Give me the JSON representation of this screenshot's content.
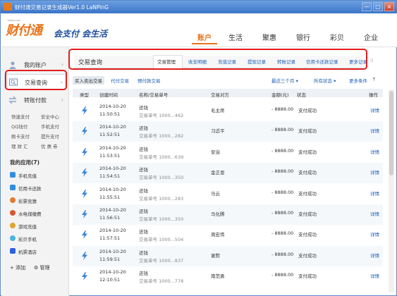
{
  "window": {
    "title": "财付通交易记录生成器Ver1.0  LaNPinG",
    "controls": [
      "—",
      "□",
      "×"
    ]
  },
  "brand": {
    "logo_main": "财付通",
    "logo_sub": "会支付 会生活",
    "logo_tag": "TENPAY.COM"
  },
  "nav": {
    "tabs": [
      "账户",
      "生活",
      "聚惠",
      "银行",
      "彩贝",
      "企业"
    ],
    "active": "账户"
  },
  "sidebar": {
    "items": [
      {
        "label": "我的账户",
        "icon": "user-icon"
      },
      {
        "label": "交易查询",
        "icon": "search-icon"
      },
      {
        "label": "转账付款",
        "icon": "transfer-icon"
      }
    ],
    "active": "交易查询",
    "shortcuts": [
      "快速支付",
      "安全中心",
      "QQ钱付",
      "手机支付",
      "刷卡支付",
      "提升支付",
      "理 财 汇",
      "优 惠 券"
    ],
    "apps_title": "我的应用(7)",
    "apps": [
      {
        "label": "手机充值",
        "color": "#2f8ee0"
      },
      {
        "label": "信用卡还款",
        "color": "#2f8ee0"
      },
      {
        "label": "彩票竞猜",
        "color": "#e07a2f"
      },
      {
        "label": "水电煤缴费",
        "color": "#e0532f"
      },
      {
        "label": "游戏充值",
        "color": "#e0a42f"
      },
      {
        "label": "彩贝手机",
        "color": "#4bb3e0"
      },
      {
        "label": "机票酒店",
        "color": "#2f5fe0"
      }
    ],
    "footer": {
      "add": "添加",
      "manage": "管理"
    }
  },
  "main": {
    "title": "交易查询",
    "subtabs": [
      "交易管理",
      "收支明细",
      "充值记录",
      "提现记录",
      "转账记录",
      "信用卡还款记录",
      "更多记录"
    ],
    "active_subtab": "交易管理",
    "filters": [
      "买入卖出交易",
      "代付交易",
      "预付款交易"
    ],
    "active_filter": "买入卖出交易",
    "range": "最近三个月 ▾",
    "status_filter": "所有状态 ▾",
    "more": "更多条件",
    "headers": [
      "类型",
      "创建时间",
      "名称/交易单号",
      "交易对方",
      "金额(元)",
      "状态",
      "操作"
    ],
    "rows": [
      {
        "date": "2014-10-20",
        "time": "11:50:51",
        "name": "还钱",
        "order": "交易单号 1000...462",
        "party": "毛主席",
        "amount": "- 8888.00",
        "status": "支付成功",
        "action": "详情"
      },
      {
        "date": "2014-10-20",
        "time": "11:52:51",
        "name": "还钱",
        "order": "交易单号 1000...282",
        "party": "习近平",
        "amount": "- 8888.00",
        "status": "支付成功",
        "action": "详情"
      },
      {
        "date": "2014-10-20",
        "time": "11:53:51",
        "name": "还钱",
        "order": "交易单号 1000...639",
        "party": "安溢",
        "amount": "- 8888.00",
        "status": "支付成功",
        "action": "详情"
      },
      {
        "date": "2014-10-20",
        "time": "11:54:51",
        "name": "还钱",
        "order": "交易单号 1000...350",
        "party": "金正恩",
        "amount": "- 8888.00",
        "status": "支付成功",
        "action": "详情"
      },
      {
        "date": "2014-10-20",
        "time": "11:55:51",
        "name": "还钱",
        "order": "交易单号 1000...283",
        "party": "马云",
        "amount": "- 8888.00",
        "status": "支付成功",
        "action": "详情"
      },
      {
        "date": "2014-10-20",
        "time": "11:56:51",
        "name": "还钱",
        "order": "交易单号 1000...350",
        "party": "马化腾",
        "amount": "- 8888.00",
        "status": "支付成功",
        "action": "详情"
      },
      {
        "date": "2014-10-20",
        "time": "11:57:51",
        "name": "还钱",
        "order": "交易单号 1000...504",
        "party": "周宏伟",
        "amount": "- 8888.00",
        "status": "支付成功",
        "action": "详情"
      },
      {
        "date": "2014-10-20",
        "time": "11:59:51",
        "name": "还钱",
        "order": "交易单号 1000...837",
        "party": "谢默",
        "amount": "- 8888.00",
        "status": "支付成功",
        "action": "详情"
      },
      {
        "date": "2014-10-20",
        "time": "12:10:51",
        "name": "还钱",
        "order": "交易单号 1000...778",
        "party": "南范勇",
        "amount": "- 8888.00",
        "status": "支付成功",
        "action": "详情"
      }
    ]
  },
  "colors": {
    "accent": "#e8731a",
    "link": "#1b5fb5",
    "highlight": "#e21d1d",
    "title_bar": "#4a84d4"
  }
}
